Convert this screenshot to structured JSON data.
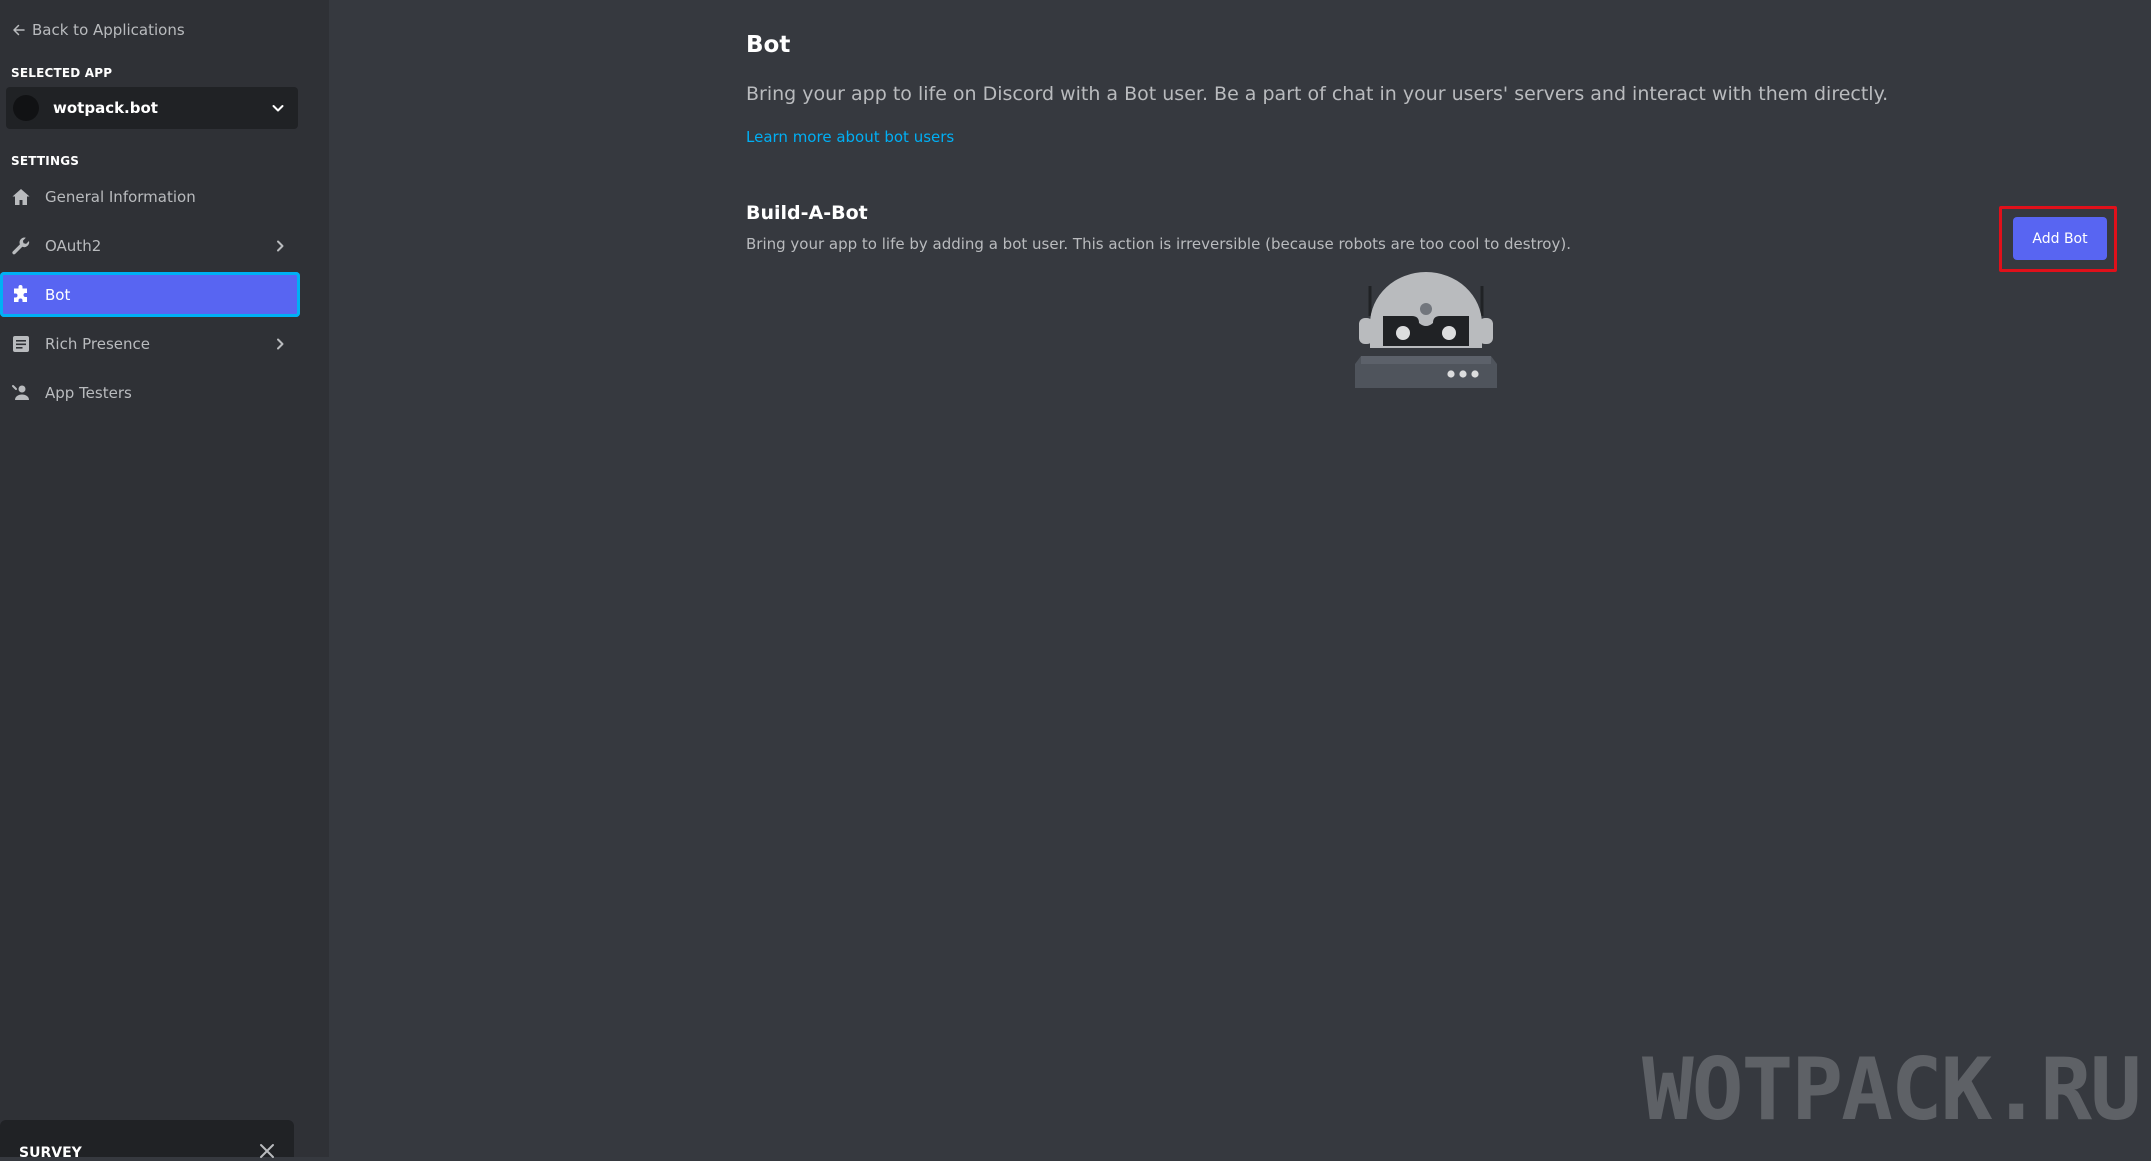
{
  "sidebar": {
    "back_label": "Back to Applications",
    "selected_app_label": "SELECTED APP",
    "selected_app_name": "wotpack.bot",
    "settings_label": "SETTINGS",
    "items": [
      {
        "label": "General Information",
        "icon": "home-icon",
        "has_chevron": false,
        "active": false
      },
      {
        "label": "OAuth2",
        "icon": "wrench-icon",
        "has_chevron": true,
        "active": false
      },
      {
        "label": "Bot",
        "icon": "puzzle-icon",
        "has_chevron": false,
        "active": true
      },
      {
        "label": "Rich Presence",
        "icon": "document-icon",
        "has_chevron": true,
        "active": false
      },
      {
        "label": "App Testers",
        "icon": "user-icon",
        "has_chevron": false,
        "active": false
      }
    ],
    "survey_label": "SURVEY"
  },
  "main": {
    "title": "Bot",
    "description": "Bring your app to life on Discord with a Bot user. Be a part of chat in your users' servers and interact with them directly.",
    "learn_more": "Learn more about bot users",
    "build_a_bot": {
      "title": "Build-A-Bot",
      "description": "Bring your app to life by adding a bot user. This action is irreversible (because robots are too cool to destroy).",
      "add_bot_label": "Add Bot"
    }
  },
  "watermark": "WOTPACK.RU",
  "colors": {
    "accent": "#5865f2",
    "active_outline": "#00b0f4",
    "link": "#00aff4",
    "highlight": "#e0101a",
    "sidebar_bg": "#2f3136",
    "main_bg": "#36393f"
  }
}
